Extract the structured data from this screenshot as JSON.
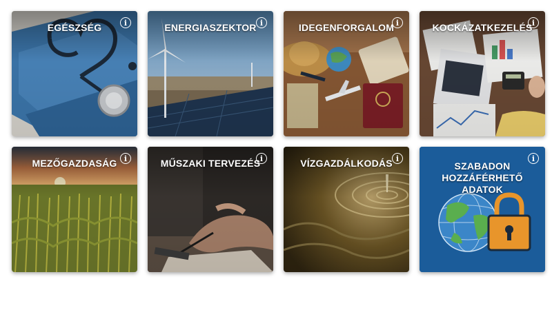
{
  "info_glyph": "i",
  "tiles": [
    {
      "title": "EGÉSZSÉG",
      "image": "stethoscope-on-blue-scrubs"
    },
    {
      "title": "ENERGIASZEKTOR",
      "image": "wind-turbine-and-solar-panels"
    },
    {
      "title": "IDEGENFORGALOM",
      "image": "travel-items-map-passport"
    },
    {
      "title": "KOCKÁZATKEZELÉS",
      "image": "charts-and-calculator-on-desk"
    },
    {
      "title": "MEZŐGAZDASÁG",
      "image": "cornfield-at-sunset"
    },
    {
      "title": "MŰSZAKI TERVEZÉS",
      "image": "hand-drawing-blueprint"
    },
    {
      "title": "VÍZGAZDÁLKODÁS",
      "image": "water-ripples"
    },
    {
      "title": "SZABADON HOZZÁFÉRHETŐ ADATOK",
      "image": "globe-with-padlock-icon"
    }
  ],
  "colors": {
    "open_data_bg": "#1b5c9a",
    "padlock": "#e8952b"
  }
}
